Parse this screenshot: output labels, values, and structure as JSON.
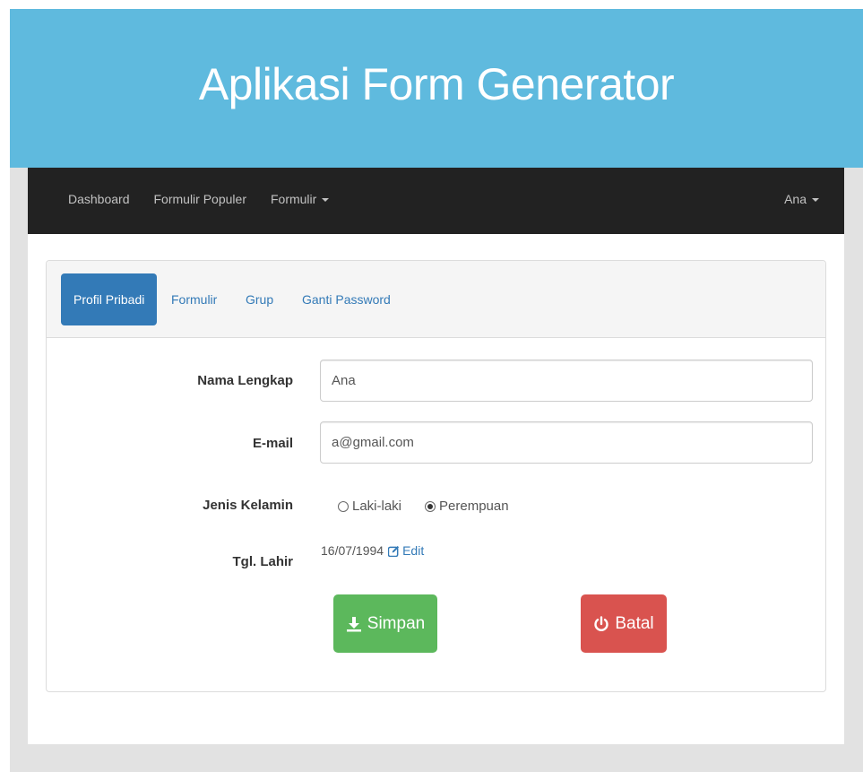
{
  "app": {
    "title": "Aplikasi Form Generator"
  },
  "navbar": {
    "items": [
      {
        "label": "Dashboard"
      },
      {
        "label": "Formulir Populer"
      },
      {
        "label": "Formulir"
      }
    ],
    "user": "Ana"
  },
  "tabs": [
    {
      "label": "Profil Pribadi",
      "active": true
    },
    {
      "label": "Formulir",
      "active": false
    },
    {
      "label": "Grup",
      "active": false
    },
    {
      "label": "Ganti Password",
      "active": false
    }
  ],
  "form": {
    "name_label": "Nama Lengkap",
    "name_value": "Ana",
    "email_label": "E-mail",
    "email_value": "a@gmail.com",
    "gender_label": "Jenis Kelamin",
    "gender_options": [
      {
        "label": "Laki-laki",
        "checked": false
      },
      {
        "label": "Perempuan",
        "checked": true
      }
    ],
    "dob_label": "Tgl. Lahir",
    "dob_value": "16/07/1994",
    "dob_edit_label": "Edit"
  },
  "buttons": {
    "save_label": "Simpan",
    "cancel_label": "Batal"
  },
  "colors": {
    "header_bg": "#5fbade",
    "navbar_bg": "#222222",
    "primary": "#337ab7",
    "success": "#5cb85c",
    "danger": "#d9534f"
  },
  "icons": {
    "save": "download-icon",
    "cancel": "power-icon",
    "edit": "edit-icon",
    "dropdown": "caret-down-icon"
  }
}
